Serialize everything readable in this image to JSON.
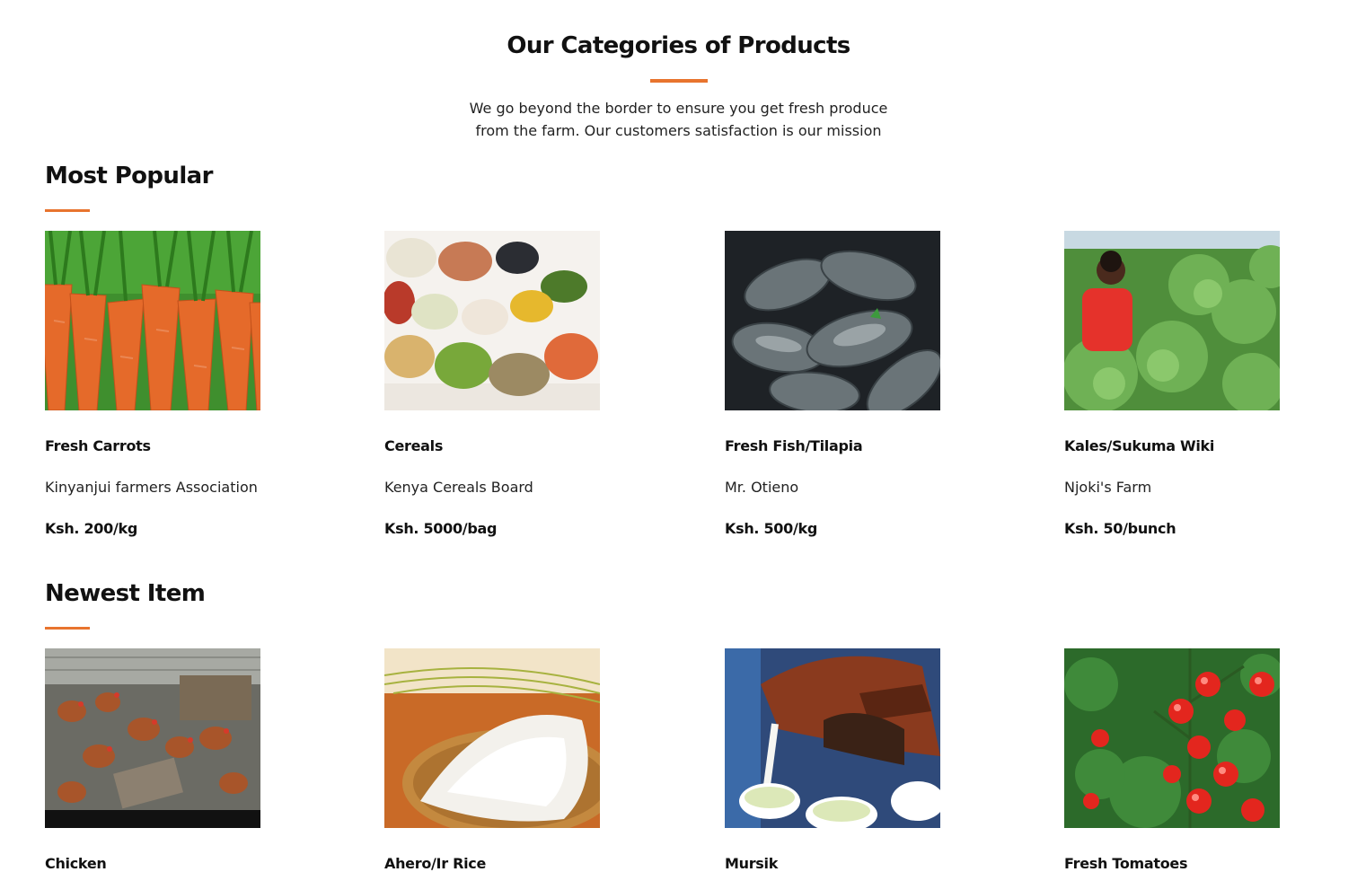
{
  "theme": {
    "accent": "#e8742e"
  },
  "header": {
    "title": "Our Categories of Products",
    "subtitle_line1": "We go beyond the border to ensure you get fresh produce",
    "subtitle_line2": "from the farm. Our customers satisfaction is our mission"
  },
  "popular": {
    "title": "Most Popular",
    "items": [
      {
        "name": "Fresh Carrots",
        "vendor": "Kinyanjui farmers Association",
        "price": "Ksh. 200/kg",
        "image": "carrots-photo"
      },
      {
        "name": "Cereals",
        "vendor": "Kenya Cereals Board",
        "price": "Ksh. 5000/bag",
        "image": "cereals-photo"
      },
      {
        "name": "Fresh Fish/Tilapia",
        "vendor": "Mr. Otieno",
        "price": "Ksh. 500/kg",
        "image": "tilapia-photo"
      },
      {
        "name": "Kales/Sukuma Wiki",
        "vendor": "Njoki's Farm",
        "price": "Ksh. 50/bunch",
        "image": "kales-photo"
      }
    ]
  },
  "newest": {
    "title": "Newest Item",
    "items": [
      {
        "name": "Chicken",
        "image": "chicken-photo"
      },
      {
        "name": "Ahero/Ir Rice",
        "image": "rice-photo"
      },
      {
        "name": "Mursik",
        "image": "mursik-photo"
      },
      {
        "name": "Fresh Tomatoes",
        "image": "tomatoes-photo"
      }
    ]
  }
}
